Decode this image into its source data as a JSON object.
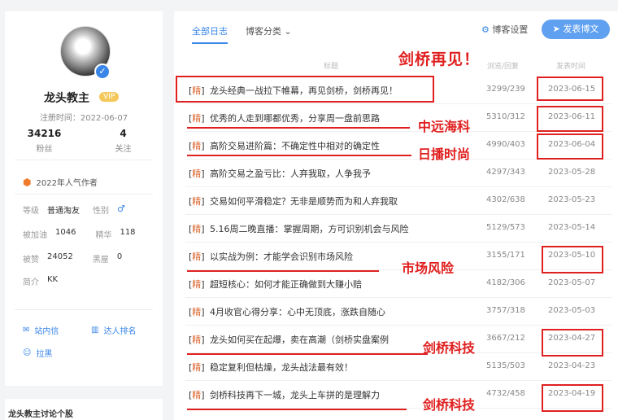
{
  "profile": {
    "username": "龙头教主",
    "vip": "VIP",
    "reg_date": "注册时间：2022-06-07",
    "fans_num": "34216",
    "fans_label": "粉丝",
    "follow_num": "4",
    "follow_label": "关注",
    "award": "2022年人气作者",
    "level_label": "等级",
    "level_value": "普通淘友",
    "gender_label": "性别",
    "gender_value": "♂",
    "jiayou_label": "被加油",
    "jiayou_value": "1046",
    "jinghua_label": "精华",
    "jinghua_value": "118",
    "zan_label": "被赞",
    "zan_value": "24052",
    "heiwu_label": "黑屋",
    "heiwu_value": "0",
    "intro_label": "简介",
    "intro_value": "KK",
    "inbox": "站内信",
    "rank": "达人排名",
    "block": "拉黑",
    "group_title": "龙头教主讨论个股"
  },
  "tabs": {
    "all": "全部日志",
    "category": "博客分类"
  },
  "settings_label": "博客设置",
  "publish_label": "发表博文",
  "columns": {
    "title": "标题",
    "views": "浏览/回复",
    "date": "发表时间"
  },
  "banner": "剑桥再见！",
  "posts": [
    {
      "tag": "精",
      "title": "龙头经典一战拉下帷幕，再见剑桥，剑桥再见！",
      "views": "3299/239",
      "date": "2023-06-15"
    },
    {
      "tag": "精",
      "title": "优秀的人走到哪都优秀，分享周一盘前思路",
      "views": "5310/312",
      "date": "2023-06-11"
    },
    {
      "tag": "精",
      "title": "高阶交易进阶篇：不确定性中相对的确定性",
      "views": "4990/403",
      "date": "2023-06-04"
    },
    {
      "tag": "精",
      "title": "高阶交易之盈亏比：人弃我取，人争我予",
      "views": "4297/343",
      "date": "2023-05-28"
    },
    {
      "tag": "精",
      "title": "交易如何平滑稳定？无非是顺势而为和人弃我取",
      "views": "4302/638",
      "date": "2023-05-23"
    },
    {
      "tag": "精",
      "title": "5.16周二晚直播：掌握周期，方可识别机会与风险",
      "views": "5129/573",
      "date": "2023-05-14"
    },
    {
      "tag": "精",
      "title": "以实战为例：才能学会识别市场风险",
      "views": "3155/171",
      "date": "2023-05-10"
    },
    {
      "tag": "精",
      "title": "超短核心：如何才能正确做到大赚小赔",
      "views": "4182/306",
      "date": "2023-05-07"
    },
    {
      "tag": "精",
      "title": "4月收官心得分享：心中无顶底，涨跌自随心",
      "views": "3757/318",
      "date": "2023-05-03"
    },
    {
      "tag": "精",
      "title": "龙头如何买在起爆，卖在高潮（剑桥实盘案例",
      "views": "3667/212",
      "date": "2023-04-27"
    },
    {
      "tag": "精",
      "title": "稳定复利但枯燥，龙头战法最有效！",
      "views": "5135/503",
      "date": "2023-04-23"
    },
    {
      "tag": "精",
      "title": "剑桥科技再下一城，龙头上车拼的是理解力",
      "views": "4732/458",
      "date": "2023-04-19"
    }
  ],
  "annotations": {
    "a1": "中远海科",
    "a2": "日播时尚",
    "a3": "市场风险",
    "a4": "剑桥科技",
    "a5": "剑桥科技"
  },
  "colors": {
    "accent": "#3a86e8",
    "annotation": "#e02020",
    "tag": "#d9622b"
  }
}
